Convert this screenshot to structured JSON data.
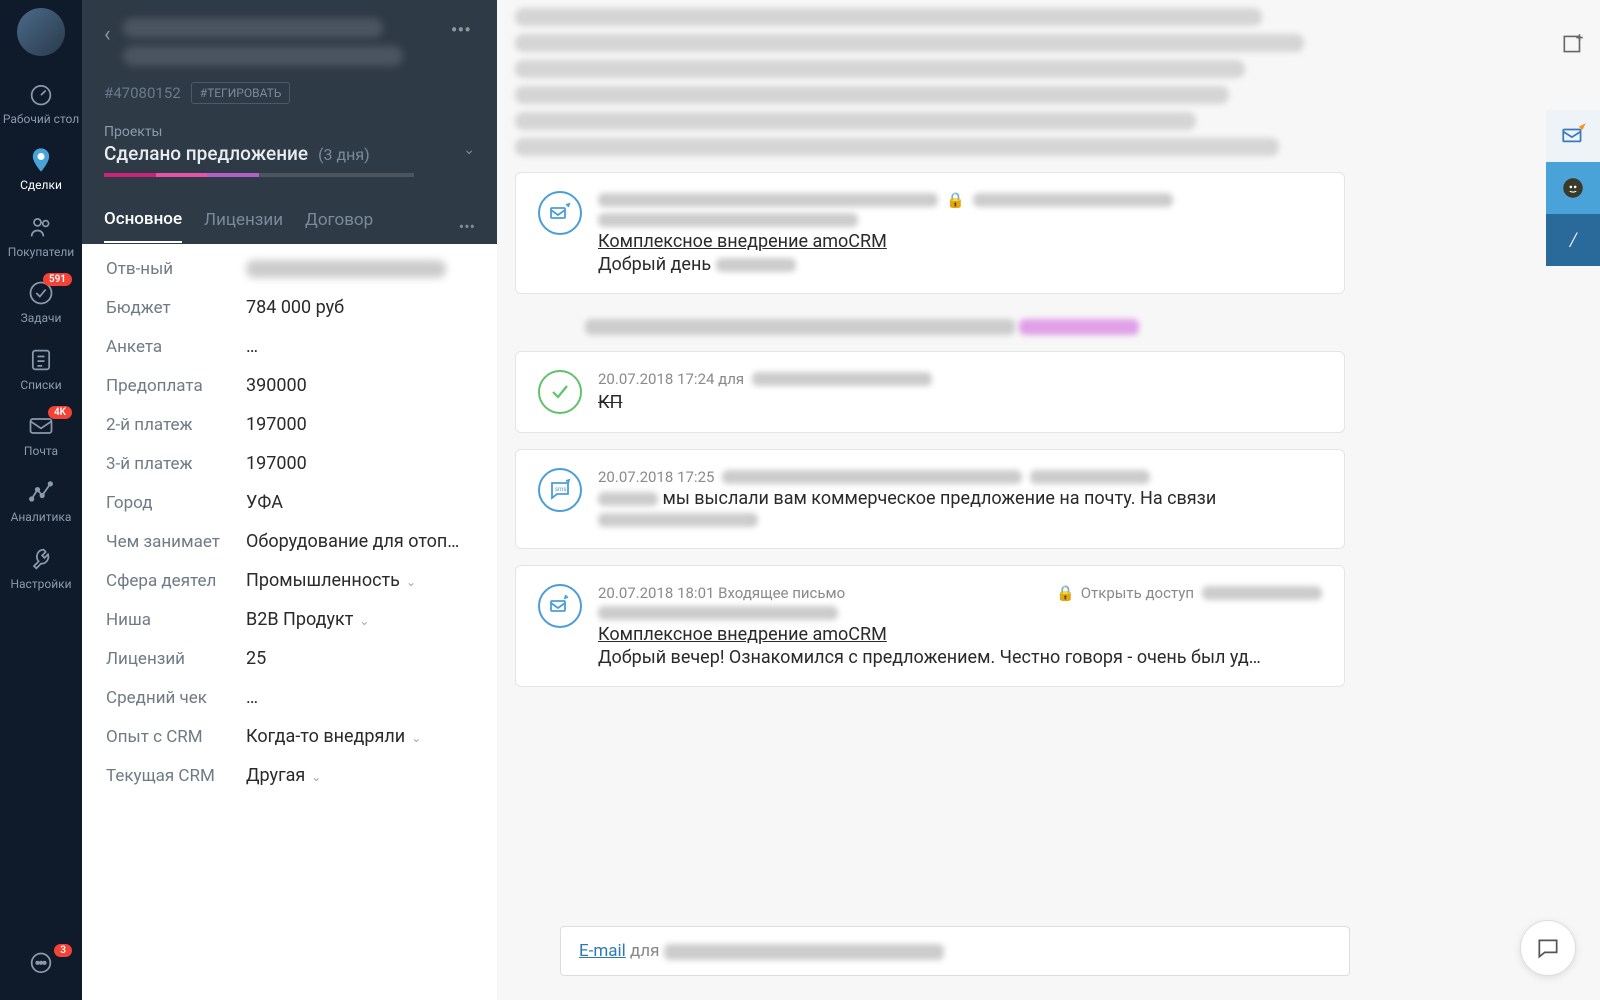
{
  "nav": {
    "items": [
      {
        "label": "Рабочий стол"
      },
      {
        "label": "Сделки"
      },
      {
        "label": "Покупатели"
      },
      {
        "label": "Задачи",
        "badge": "591"
      },
      {
        "label": "Списки"
      },
      {
        "label": "Почта",
        "badge": "4K"
      },
      {
        "label": "Аналитика"
      },
      {
        "label": "Настройки"
      }
    ],
    "chat_badge": "3"
  },
  "deal": {
    "id": "#47080152",
    "tag_btn": "#ТЕГИРОВАТЬ",
    "pipeline_label": "Проекты",
    "stage": "Сделано предложение",
    "days": "(3 дня)",
    "tabs": {
      "main": "Основное",
      "lic": "Лицензии",
      "contract": "Договор"
    }
  },
  "fields": {
    "responsible": {
      "label": "Отв-ный"
    },
    "budget": {
      "label": "Бюджет",
      "value": "784 000 руб"
    },
    "anketa": {
      "label": "Анкета",
      "value": "…"
    },
    "prepay": {
      "label": "Предоплата",
      "value": "390000"
    },
    "pay2": {
      "label": "2-й платеж",
      "value": "197000"
    },
    "pay3": {
      "label": "3-й платеж",
      "value": "197000"
    },
    "city": {
      "label": "Город",
      "value": "УФА"
    },
    "activity": {
      "label": "Чем занимает",
      "value": "Оборудование для отоп…"
    },
    "sphere": {
      "label": "Сфера деятел",
      "value": "Промышленность"
    },
    "niche": {
      "label": "Ниша",
      "value": "B2B Продукт"
    },
    "licenses": {
      "label": "Лицензий",
      "value": "25"
    },
    "avgcheck": {
      "label": "Средний чек",
      "value": "…"
    },
    "crmexp": {
      "label": "Опыт с CRM",
      "value": "Когда-то внедряли"
    },
    "curcrm": {
      "label": "Текущая CRM",
      "value": "Другая"
    }
  },
  "feed": {
    "email1": {
      "subject": "Комплексное внедрение amoCRM",
      "snippet_prefix": "Добрый день"
    },
    "task": {
      "meta": "20.07.2018 17:24  для",
      "title": "КП"
    },
    "sms": {
      "meta": "20.07.2018 17:25",
      "text_mid": "мы выслали вам коммерческое предложение на почту. На связи"
    },
    "email2": {
      "meta": "20.07.2018 18:01 Входящее письмо",
      "access": "Открыть доступ",
      "subject": "Комплексное внедрение amoCRM",
      "snippet": "Добрый вечер! Ознакомился с предложением. Честно говоря - очень был уд…"
    }
  },
  "compose": {
    "mode": "E-mail",
    "for": "для"
  }
}
